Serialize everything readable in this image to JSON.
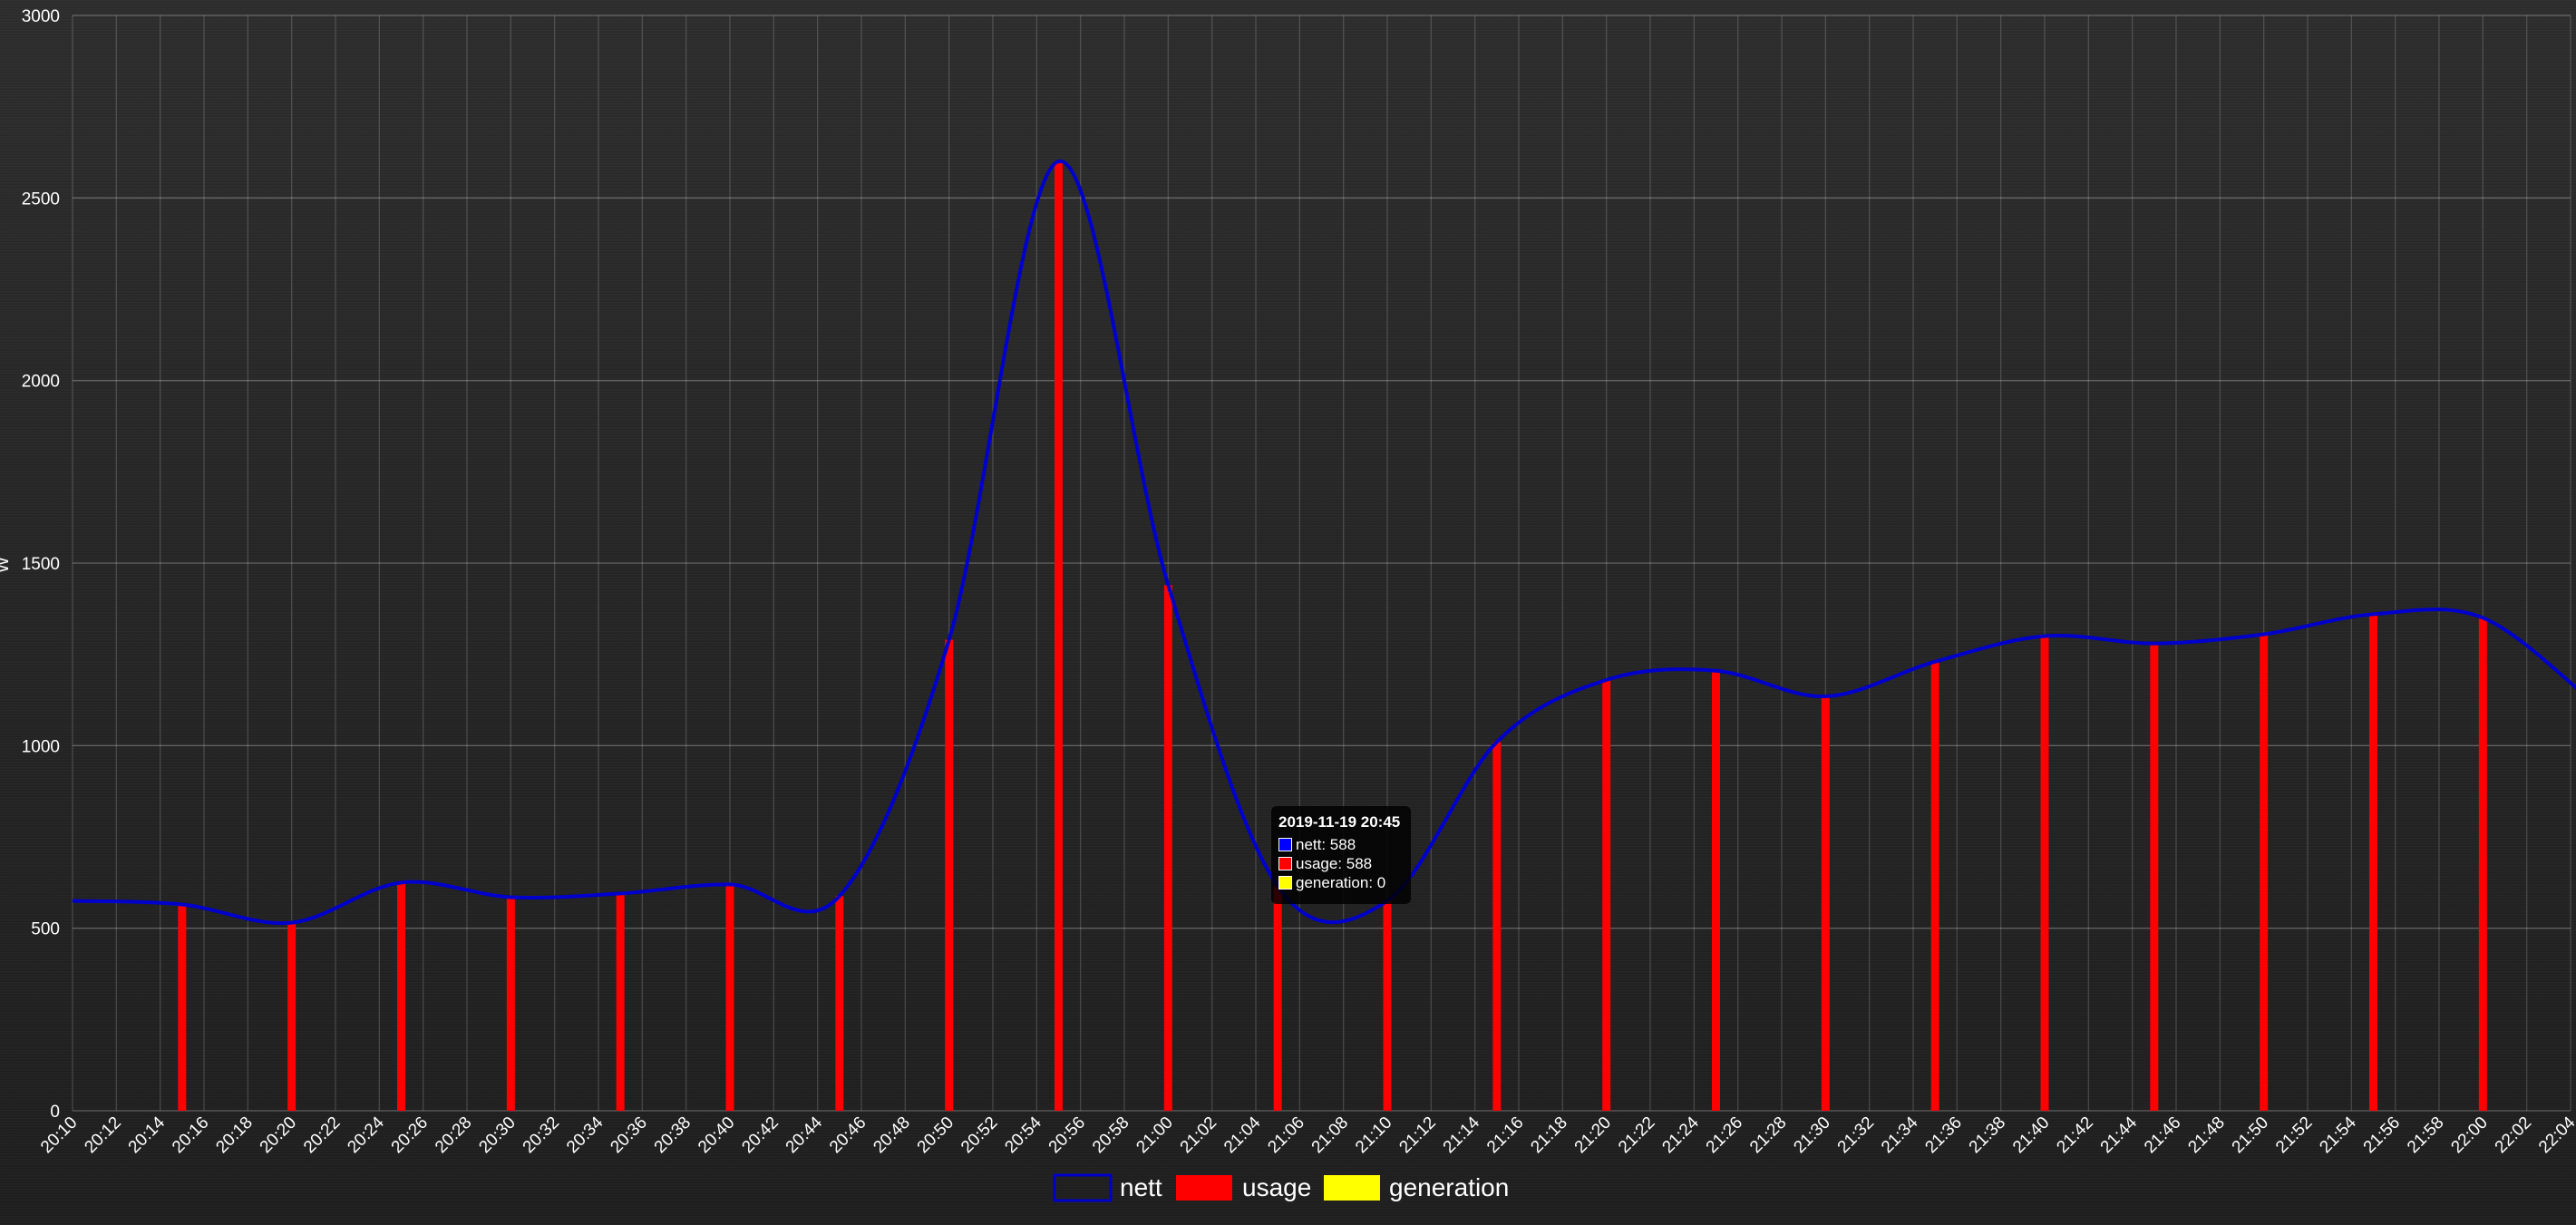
{
  "chart_data": {
    "type": "bar",
    "y_axis_label": "W",
    "ylim": [
      0,
      3000
    ],
    "y_ticks": [
      0,
      500,
      1000,
      1500,
      2000,
      2500,
      3000
    ],
    "x_tick_labels": [
      "20:10",
      "20:12",
      "20:14",
      "20:16",
      "20:18",
      "20:20",
      "20:22",
      "20:24",
      "20:26",
      "20:28",
      "20:30",
      "20:32",
      "20:34",
      "20:36",
      "20:38",
      "20:40",
      "20:42",
      "20:44",
      "20:46",
      "20:48",
      "20:50",
      "20:52",
      "20:54",
      "20:56",
      "20:58",
      "21:00",
      "21:02",
      "21:04",
      "21:06",
      "21:08",
      "21:10",
      "21:12",
      "21:14",
      "21:16",
      "21:18",
      "21:20",
      "21:22",
      "21:24",
      "21:26",
      "21:28",
      "21:30",
      "21:32",
      "21:34",
      "21:36",
      "21:38",
      "21:40",
      "21:42",
      "21:44",
      "21:46",
      "21:48",
      "21:50",
      "21:52",
      "21:54",
      "21:56",
      "21:58",
      "22:00",
      "22:02",
      "22:04"
    ],
    "categories": [
      "20:10",
      "20:15",
      "20:20",
      "20:25",
      "20:30",
      "20:35",
      "20:40",
      "20:45",
      "20:50",
      "20:55",
      "21:00",
      "21:05",
      "21:10",
      "21:15",
      "21:20",
      "21:25",
      "21:30",
      "21:35",
      "21:40",
      "21:45",
      "21:50",
      "21:55",
      "22:00",
      "22:05"
    ],
    "series": [
      {
        "name": "nett",
        "type": "line",
        "color": "#0000cc",
        "values": [
          575,
          565,
          515,
          625,
          585,
          595,
          620,
          588,
          1290,
          2600,
          1440,
          615,
          575,
          1010,
          1180,
          1205,
          1135,
          1230,
          1300,
          1280,
          1305,
          1360,
          1350,
          1120
        ]
      },
      {
        "name": "usage",
        "type": "bar",
        "color": "#ff0000",
        "values": [
          0,
          565,
          515,
          625,
          585,
          595,
          620,
          588,
          1290,
          2600,
          1440,
          615,
          575,
          1010,
          1180,
          1205,
          1135,
          1230,
          1300,
          1280,
          1305,
          1360,
          1350,
          1120
        ]
      },
      {
        "name": "generation",
        "type": "bar",
        "color": "#ffff00",
        "values": [
          0,
          0,
          0,
          0,
          0,
          0,
          0,
          0,
          0,
          0,
          0,
          0,
          0,
          0,
          0,
          0,
          0,
          0,
          0,
          0,
          0,
          0,
          0,
          0
        ]
      }
    ],
    "grid": true,
    "legend_position": "bottom"
  },
  "tooltip": {
    "title": "2019-11-19 20:45",
    "lines": [
      "nett: 588",
      "usage: 588",
      "generation: 0"
    ]
  }
}
